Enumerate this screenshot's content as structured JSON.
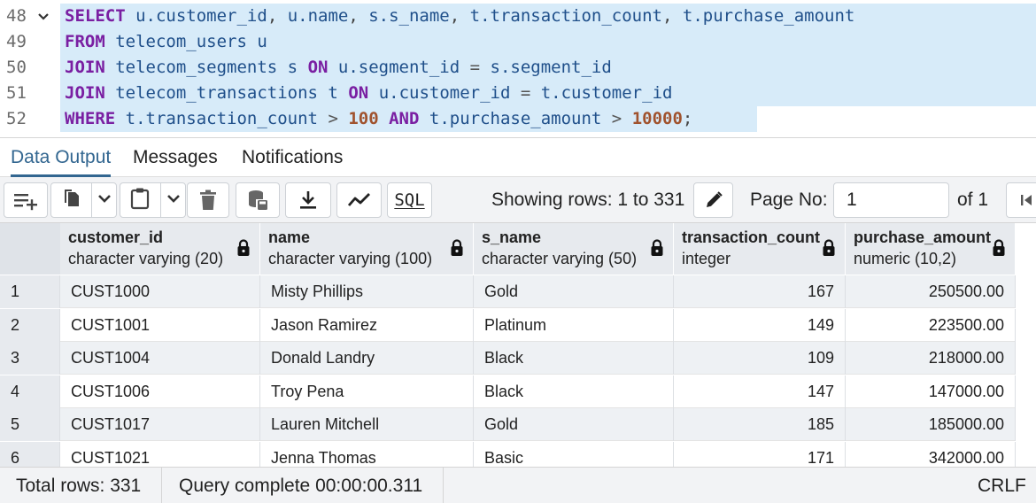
{
  "editor": {
    "lines": [
      {
        "num": "48",
        "fold": true,
        "tokens": [
          {
            "t": "kw",
            "v": "SELECT"
          },
          {
            "t": "sp",
            "v": " "
          },
          {
            "t": "id",
            "v": "u.customer_id"
          },
          {
            "t": "punc",
            "v": ", "
          },
          {
            "t": "id",
            "v": "u.name"
          },
          {
            "t": "punc",
            "v": ", "
          },
          {
            "t": "id",
            "v": "s.s_name"
          },
          {
            "t": "punc",
            "v": ", "
          },
          {
            "t": "id",
            "v": "t.transaction_count"
          },
          {
            "t": "punc",
            "v": ", "
          },
          {
            "t": "id",
            "v": "t.purchase_amount"
          }
        ]
      },
      {
        "num": "49",
        "fold": false,
        "tokens": [
          {
            "t": "kw",
            "v": "FROM"
          },
          {
            "t": "sp",
            "v": " "
          },
          {
            "t": "id",
            "v": "telecom_users u"
          }
        ]
      },
      {
        "num": "50",
        "fold": false,
        "tokens": [
          {
            "t": "kw",
            "v": "JOIN"
          },
          {
            "t": "sp",
            "v": " "
          },
          {
            "t": "id",
            "v": "telecom_segments s"
          },
          {
            "t": "sp",
            "v": " "
          },
          {
            "t": "kw",
            "v": "ON"
          },
          {
            "t": "sp",
            "v": " "
          },
          {
            "t": "id",
            "v": "u.segment_id"
          },
          {
            "t": "op",
            "v": " = "
          },
          {
            "t": "id",
            "v": "s.segment_id"
          }
        ]
      },
      {
        "num": "51",
        "fold": false,
        "tokens": [
          {
            "t": "kw",
            "v": "JOIN"
          },
          {
            "t": "sp",
            "v": " "
          },
          {
            "t": "id",
            "v": "telecom_transactions t"
          },
          {
            "t": "sp",
            "v": " "
          },
          {
            "t": "kw",
            "v": "ON"
          },
          {
            "t": "sp",
            "v": " "
          },
          {
            "t": "id",
            "v": "u.customer_id"
          },
          {
            "t": "op",
            "v": " = "
          },
          {
            "t": "id",
            "v": "t.customer_id"
          }
        ]
      },
      {
        "num": "52",
        "fold": false,
        "tokens": [
          {
            "t": "kw",
            "v": "WHERE"
          },
          {
            "t": "sp",
            "v": " "
          },
          {
            "t": "id",
            "v": "t.transaction_count"
          },
          {
            "t": "op",
            "v": " > "
          },
          {
            "t": "num",
            "v": "100"
          },
          {
            "t": "sp",
            "v": " "
          },
          {
            "t": "kw",
            "v": "AND"
          },
          {
            "t": "sp",
            "v": " "
          },
          {
            "t": "id",
            "v": "t.purchase_amount"
          },
          {
            "t": "op",
            "v": " > "
          },
          {
            "t": "num",
            "v": "10000"
          },
          {
            "t": "punc",
            "v": ";"
          }
        ]
      }
    ]
  },
  "tabs": [
    {
      "label": "Data Output",
      "active": true
    },
    {
      "label": "Messages",
      "active": false
    },
    {
      "label": "Notifications",
      "active": false
    }
  ],
  "toolbar": {
    "showing_rows": "Showing rows: 1 to 331",
    "page_no_label": "Page No:",
    "page_no_value": "1",
    "of_label": "of 1",
    "sql_label": "SQL",
    "icons": [
      "add-row-icon",
      "copy-icon",
      "chevron-down-icon",
      "paste-icon",
      "chevron-down-icon",
      "delete-icon",
      "save-data-icon",
      "download-icon",
      "graph-icon",
      "sql-icon",
      "edit-icon",
      "first-page-icon"
    ]
  },
  "grid": {
    "columns": [
      {
        "name": "customer_id",
        "type": "character varying (20)",
        "align": "left"
      },
      {
        "name": "name",
        "type": "character varying (100)",
        "align": "left"
      },
      {
        "name": "s_name",
        "type": "character varying (50)",
        "align": "left"
      },
      {
        "name": "transaction_count",
        "type": "integer",
        "align": "right"
      },
      {
        "name": "purchase_amount",
        "type": "numeric (10,2)",
        "align": "right"
      }
    ],
    "rows": [
      {
        "rn": "1",
        "cells": [
          "CUST1000",
          "Misty Phillips",
          "Gold",
          "167",
          "250500.00"
        ]
      },
      {
        "rn": "2",
        "cells": [
          "CUST1001",
          "Jason Ramirez",
          "Platinum",
          "149",
          "223500.00"
        ]
      },
      {
        "rn": "3",
        "cells": [
          "CUST1004",
          "Donald Landry",
          "Black",
          "109",
          "218000.00"
        ]
      },
      {
        "rn": "4",
        "cells": [
          "CUST1006",
          "Troy Pena",
          "Black",
          "147",
          "147000.00"
        ]
      },
      {
        "rn": "5",
        "cells": [
          "CUST1017",
          "Lauren Mitchell",
          "Gold",
          "185",
          "185000.00"
        ]
      },
      {
        "rn": "6",
        "cells": [
          "CUST1021",
          "Jenna Thomas",
          "Basic",
          "171",
          "342000.00"
        ]
      }
    ]
  },
  "status": {
    "total_rows": "Total rows: 331",
    "query_complete": "Query complete 00:00:00.311",
    "line_ending": "CRLF"
  },
  "colors": {
    "keyword": "#7a1fa2",
    "identifier": "#1f4f8a",
    "number": "#a0522d",
    "selection": "#d7ebf9",
    "active_tab": "#326690"
  }
}
